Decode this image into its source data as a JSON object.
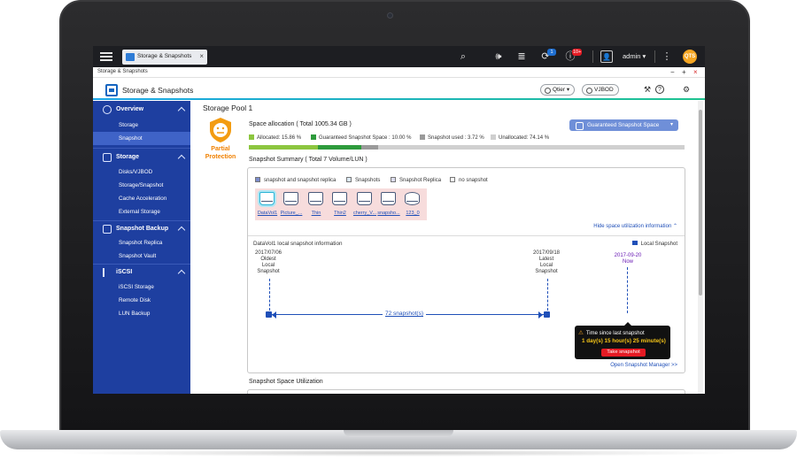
{
  "topbar": {
    "app_tab_label": "Storage & Snapshots",
    "user": "admin",
    "notif_badge_1": "1",
    "notif_badge_2": "10+",
    "avatar_text": "QTS"
  },
  "window": {
    "title": "Storage & Snapshots"
  },
  "header": {
    "app_name": "Storage & Snapshots",
    "qtier": "Qtier",
    "vjbod": "VJBOD"
  },
  "sidebar": {
    "groups": [
      {
        "label": "Overview",
        "items": [
          "Storage",
          "Snapshot"
        ]
      },
      {
        "label": "Storage",
        "items": [
          "Disks/VJBOD",
          "Storage/Snapshot",
          "Cache Acceleration",
          "External Storage"
        ]
      },
      {
        "label": "Snapshot Backup",
        "items": [
          "Snapshot Replica",
          "Snapshot Vault"
        ]
      },
      {
        "label": "iSCSI",
        "items": [
          "iSCSI Storage",
          "Remote Disk",
          "LUN Backup"
        ]
      }
    ],
    "active_item": "Snapshot"
  },
  "main": {
    "pool_title": "Storage Pool 1",
    "status_label": "Partial Protection",
    "space_title": "Space allocation ( Total 1005.34 GB )",
    "gss_button": "Guaranteed Snapshot Space",
    "legend": [
      {
        "label": "Allocated: 15.86 %",
        "color": "#8cc63f",
        "value": 15.86
      },
      {
        "label": "Guaranteed Snapshot Space : 10.00 %",
        "color": "#2e9b3c",
        "value": 10.0
      },
      {
        "label": "Snapshot used : 3.72 %",
        "color": "#9a9a9a",
        "value": 3.72
      },
      {
        "label": "Unallocated: 74.14 %",
        "color": "#cfcfcf",
        "value": 74.14
      }
    ],
    "summary_title": "Snapshot Summary ( Total 7 Volume/LUN )",
    "panel_legend": [
      {
        "label": "snapshot and snapshot replica",
        "color": "#7b8ccc"
      },
      {
        "label": "Snapshots",
        "color": "#dbe9f7"
      },
      {
        "label": "Snapshot Replica",
        "color": "#dcdcef"
      },
      {
        "label": "no snapshot",
        "color": "#ffffff"
      }
    ],
    "volumes": [
      "DataVol1",
      "Picture_...",
      "Thin",
      "Thin2",
      "cherry_V...",
      "snapsho...",
      "123_0"
    ],
    "hide_link": "Hide space utilization information",
    "local_title": "DataVol1 local snapshot information",
    "local_snapshot_label": "Local Snapshot",
    "oldest_date": "2017/07/06",
    "oldest_label": "Oldest",
    "oldest_label2": "Local",
    "oldest_label3": "Snapshot",
    "latest_date": "2017/09/18",
    "latest_label": "Latest",
    "latest_label2": "Local",
    "latest_label3": "Snapshot",
    "now_date": "2017-09-20",
    "now_label": "Now",
    "snapshot_count": "72 snapshot(s)",
    "callout_title": "Time since last snapshot",
    "callout_value": "1 day(s) 15 hour(s) 25 minute(s)",
    "take_snapshot": "Take snapshot",
    "open_link": "Open Snapshot Manager >>",
    "util_title": "Snapshot Space Utilization"
  }
}
